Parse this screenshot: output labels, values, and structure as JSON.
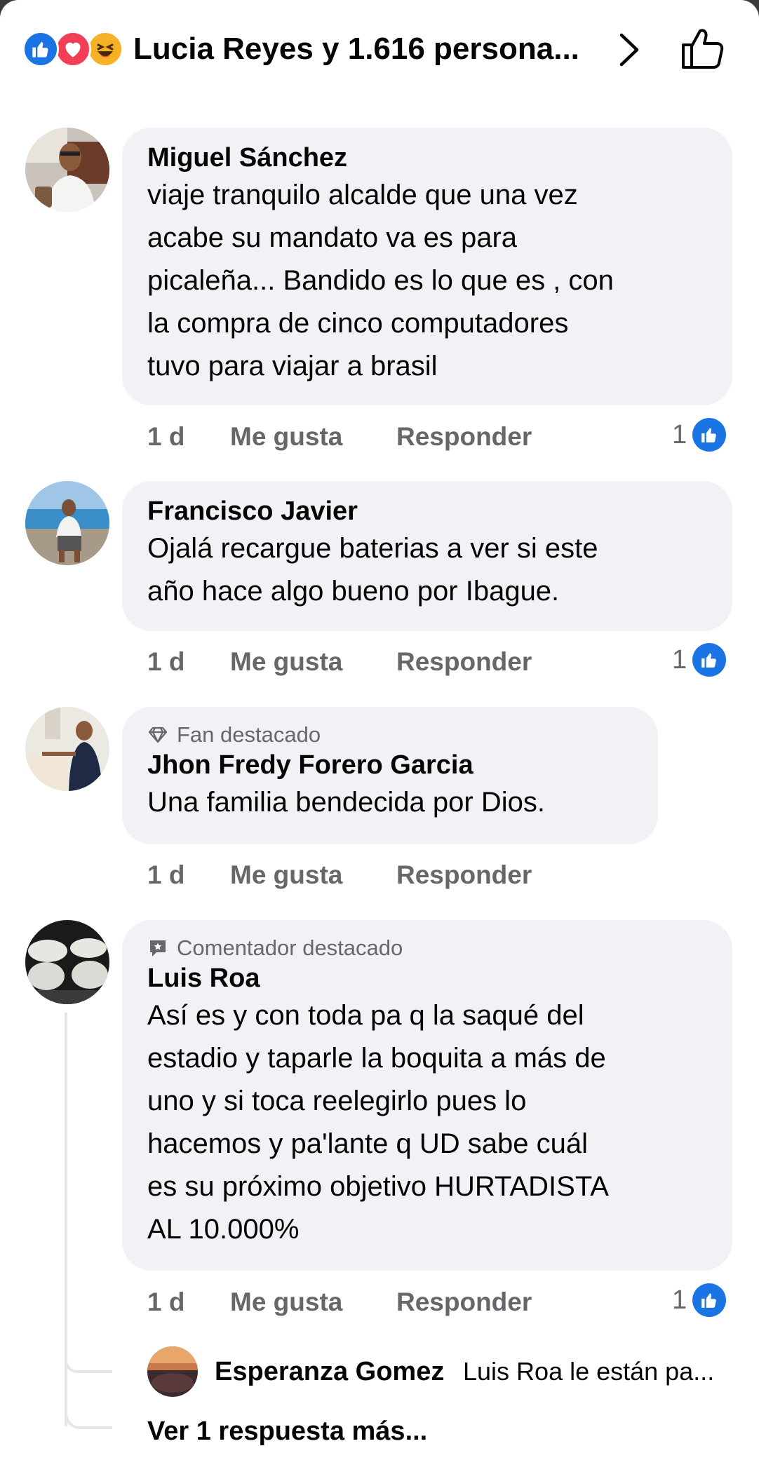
{
  "header": {
    "title": "Lucia Reyes y 1.616 persona...",
    "reactions": [
      "like-icon",
      "love-icon",
      "haha-icon"
    ]
  },
  "comments": [
    {
      "author": "Miguel Sánchez",
      "badge": "",
      "lines": [
        "viaje tranquilo alcalde que una vez",
        "acabe su mandato va es para",
        "picaleña... Bandido es lo que es , con",
        "la compra de cinco computadores",
        "tuvo para viajar a brasil"
      ],
      "time": "1 d",
      "like_label": "Me gusta",
      "reply_label": "Responder",
      "likes": "1"
    },
    {
      "author": "Francisco Javier",
      "badge": "",
      "lines": [
        "Ojalá recargue baterias a ver si este",
        "año hace algo bueno por Ibague."
      ],
      "time": "1 d",
      "like_label": "Me gusta",
      "reply_label": "Responder",
      "likes": "1"
    },
    {
      "author": "Jhon Fredy Forero Garcia",
      "badge": "Fan destacado",
      "lines": [
        "Una familia bendecida por Dios."
      ],
      "time": "1 d",
      "like_label": "Me gusta",
      "reply_label": "Responder",
      "likes": ""
    },
    {
      "author": "Luis Roa",
      "badge": "Comentador destacado",
      "lines": [
        "Así es y con toda pa q la saqué del",
        "estadio y taparle la boquita a más de",
        "uno y si toca reelegirlo pues lo",
        "hacemos y pa'lante q UD sabe cuál",
        "es su próximo objetivo HURTADISTA",
        "AL 10.000%"
      ],
      "time": "1 d",
      "like_label": "Me gusta",
      "reply_label": "Responder",
      "likes": "1"
    }
  ],
  "reply": {
    "author": "Esperanza Gomez",
    "preview": "Luis Roa  le están pa..."
  },
  "more_replies": "Ver 1 respuesta más...",
  "colors": {
    "bubble": "#f0f2f5",
    "secondary_text": "#65676b",
    "like_blue": "#1b74e4"
  }
}
